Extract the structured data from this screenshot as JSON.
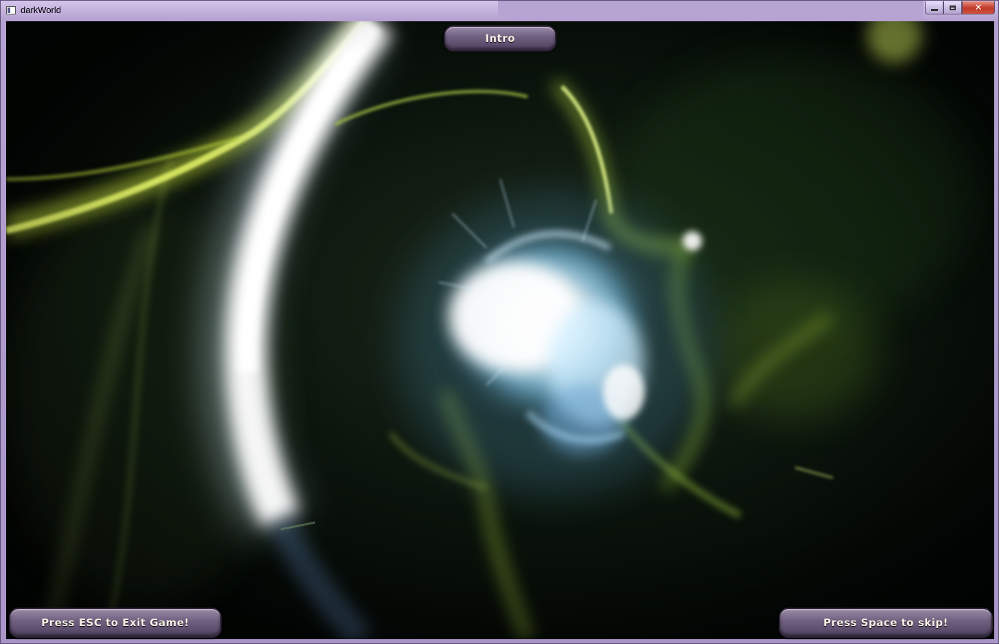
{
  "window": {
    "title": "darkWorld"
  },
  "hud": {
    "scene_label": "Intro",
    "exit_hint": "Press ESC to Exit Game!",
    "skip_hint": "Press Space to skip!"
  },
  "colors": {
    "frame": "#a995c8",
    "button": "#6e5f7e",
    "button_text": "#f5f0e6",
    "energy_green": "#c7e04a",
    "energy_blue": "#bfe6ff",
    "background": "#020503"
  },
  "icons": {
    "app": "window-icon",
    "minimize": "minimize-icon",
    "maximize": "maximize-icon",
    "close": "close-icon"
  }
}
